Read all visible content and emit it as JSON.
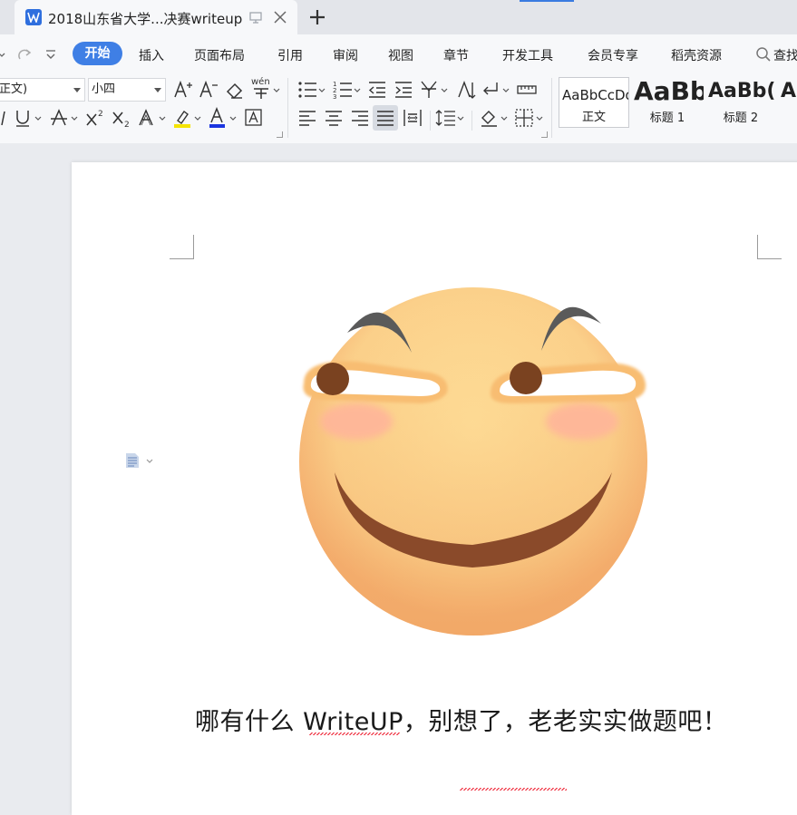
{
  "tab": {
    "title": "2018山东省大学...决赛writeup"
  },
  "menu": {
    "active": "开始",
    "items": [
      "插入",
      "页面布局",
      "引用",
      "审阅",
      "视图",
      "章节",
      "开发工具",
      "会员专享",
      "稻壳资源"
    ],
    "search_label": "查找"
  },
  "ribbon": {
    "font_name": "正文)",
    "font_size": "小四",
    "pinyin_label": "wén",
    "styles": [
      {
        "sample": "AaBbCcDd",
        "name": "正文"
      },
      {
        "sample": "AaBb",
        "name": "标题 1"
      },
      {
        "sample": "AaBb(",
        "name": "标题 2"
      },
      {
        "sample": "A",
        "name": ""
      }
    ]
  },
  "document": {
    "body_text": "哪有什么 WriteUP，别想了，老老实实做题吧！"
  },
  "colors": {
    "accent": "#3f7fe5",
    "highlight": "#f5e400",
    "font_color": "#1b35e0",
    "face": "#fcd58a",
    "face_edge": "#f4a96b",
    "brow": "#5a5a5a",
    "mouth": "#8a4a2a",
    "pupil": "#7a4220",
    "blush": "#ffb59a"
  }
}
